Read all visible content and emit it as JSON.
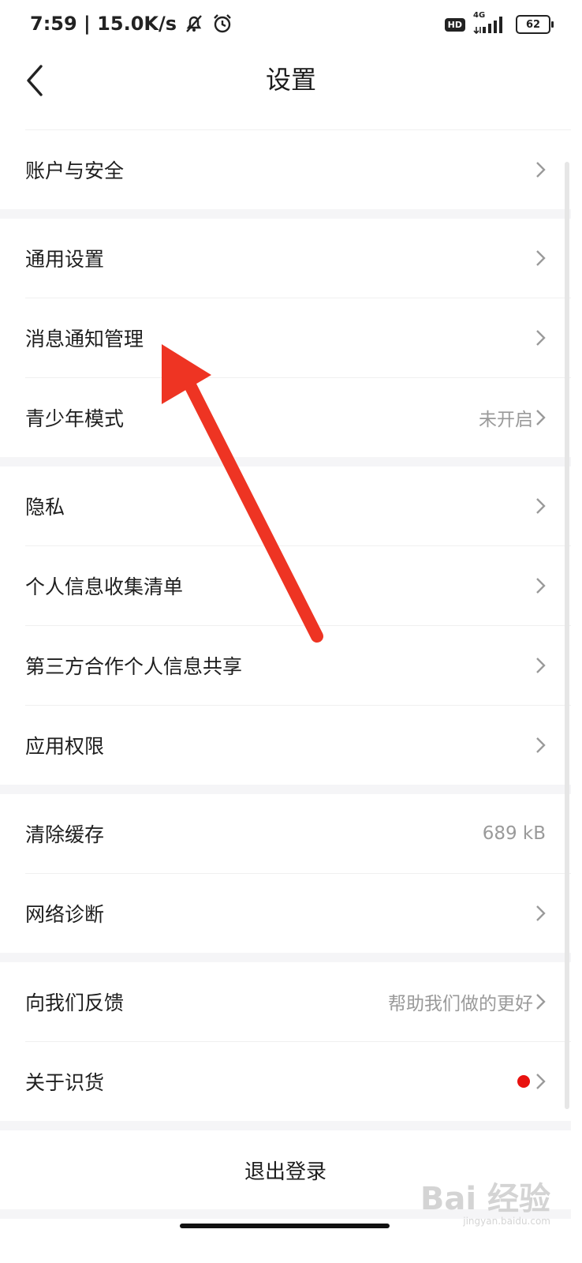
{
  "status_bar": {
    "time_speed": "7:59 | 15.0K/s",
    "hd": "HD",
    "network": "4G",
    "battery": "62"
  },
  "header": {
    "title": "设置"
  },
  "sections": [
    {
      "items": [
        {
          "label": "账户与安全",
          "value": ""
        }
      ]
    },
    {
      "items": [
        {
          "label": "通用设置",
          "value": ""
        },
        {
          "label": "消息通知管理",
          "value": ""
        },
        {
          "label": "青少年模式",
          "value": "未开启"
        }
      ]
    },
    {
      "items": [
        {
          "label": "隐私",
          "value": ""
        },
        {
          "label": "个人信息收集清单",
          "value": ""
        },
        {
          "label": "第三方合作个人信息共享",
          "value": ""
        },
        {
          "label": "应用权限",
          "value": ""
        }
      ]
    },
    {
      "items": [
        {
          "label": "清除缓存",
          "value": "689 kB"
        },
        {
          "label": "网络诊断",
          "value": ""
        }
      ]
    },
    {
      "items": [
        {
          "label": "向我们反馈",
          "value": "帮助我们做的更好"
        },
        {
          "label": "关于识货",
          "value": ""
        }
      ]
    }
  ],
  "logout_label": "退出登录",
  "watermark": {
    "brand": "Bai 经验",
    "url": "jingyan.baidu.com"
  },
  "colors": {
    "arrow": "#ee3423",
    "badge": "#e8120f",
    "section_gap": "#f5f5f7"
  }
}
